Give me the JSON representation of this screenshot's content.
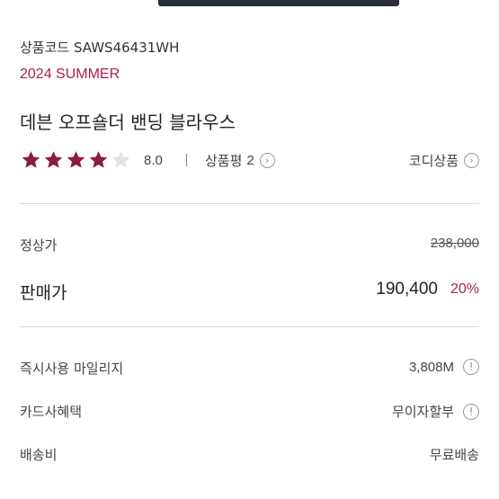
{
  "product": {
    "code_label": "상품코드 SAWS46431WH",
    "season": "2024 SUMMER",
    "title": "데븐 오프숄더 밴딩 블라우스"
  },
  "rating": {
    "stars_filled": 4,
    "stars_total": 5,
    "score": "8.0",
    "review_label": "상품평",
    "review_count": "2",
    "coordi_label": "코디상품"
  },
  "price": {
    "regular_label": "정상가",
    "regular_price": "238,000",
    "sale_label": "판매가",
    "sale_price": "190,400",
    "discount": "20%"
  },
  "benefits": {
    "mileage_label": "즉시사용 마일리지",
    "mileage_value": "3,808M",
    "card_label": "카드사혜택",
    "card_value": "무이자할부",
    "shipping_label": "배송비",
    "shipping_value": "무료배송"
  },
  "colors": {
    "accent": "#a8234a",
    "star_filled": "#8b1e3f",
    "star_empty": "#e2e2e2"
  },
  "icons": {
    "chevron": "›",
    "info": "!"
  }
}
